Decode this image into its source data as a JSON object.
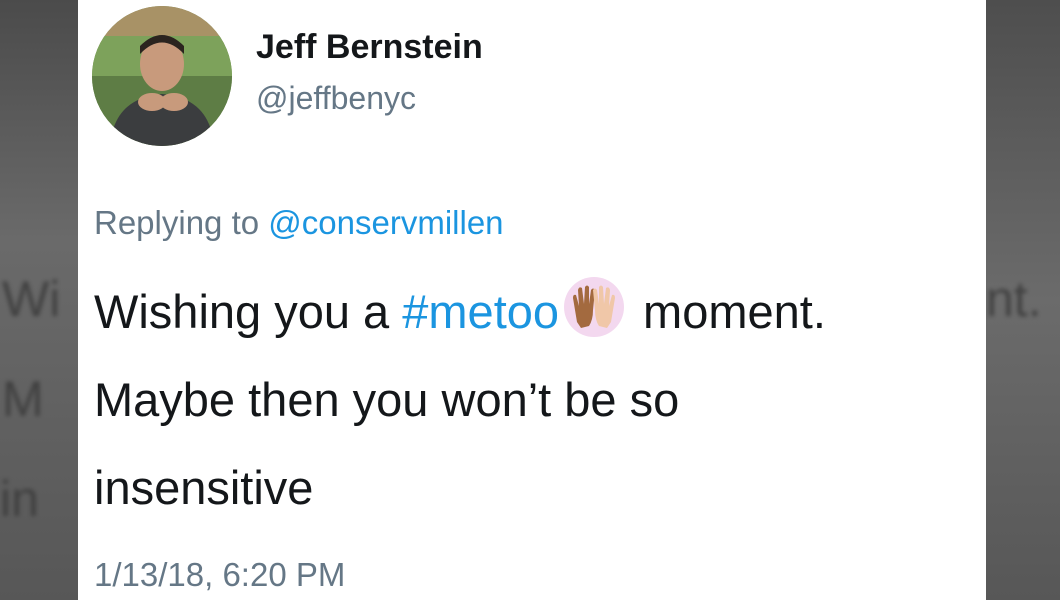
{
  "user": {
    "display_name": "Jeff Bernstein",
    "handle": "@jeffbenyc"
  },
  "reply": {
    "prefix": "Replying to",
    "mention": "@conservmillen"
  },
  "tweet": {
    "text_before": "Wishing you a ",
    "hashtag": "#metoo",
    "emoji": "raised-hands-icon",
    "text_line1_end": "moment.",
    "text_line2": "Maybe then you won’t be so",
    "text_line3": "insensitive"
  },
  "timestamp": "1/13/18, 6:20 PM",
  "colors": {
    "link": "#1b95e0",
    "secondary_text": "#657786",
    "primary_text": "#14171a"
  }
}
